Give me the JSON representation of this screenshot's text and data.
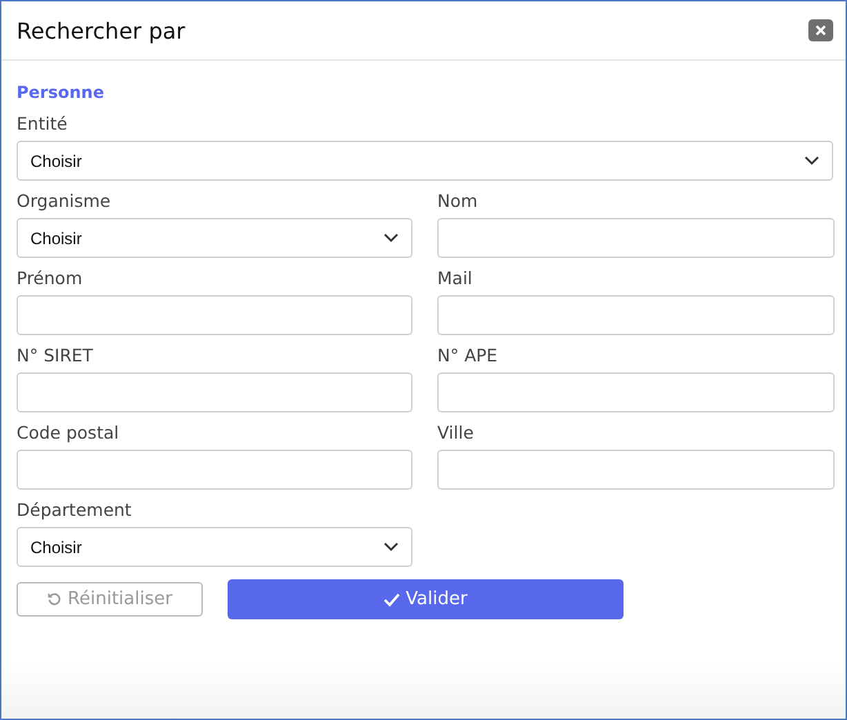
{
  "window": {
    "title": "Rechercher par"
  },
  "section": "Personne",
  "rows": [
    [
      {
        "label": "Entité",
        "kind": "select",
        "value": "Choisir"
      }
    ],
    [
      {
        "label": "Organisme",
        "kind": "select",
        "value": "Choisir"
      },
      {
        "label": "Nom",
        "kind": "text"
      }
    ],
    [
      {
        "label": "Prénom",
        "kind": "text"
      },
      {
        "label": "Mail",
        "kind": "text"
      }
    ],
    [
      {
        "label": "N° SIRET",
        "kind": "text"
      },
      {
        "label": "N° APE",
        "kind": "text"
      }
    ],
    [
      {
        "label": "Code postal",
        "kind": "text"
      },
      {
        "label": "Ville",
        "kind": "text"
      }
    ],
    [
      {
        "label": "Département",
        "kind": "select",
        "value": "Choisir"
      }
    ]
  ],
  "buttons": [
    {
      "label": "Réinitialiser",
      "kind": "reset",
      "disabled": true
    },
    {
      "label": "Valider",
      "kind": "submit",
      "disabled": false
    }
  ]
}
